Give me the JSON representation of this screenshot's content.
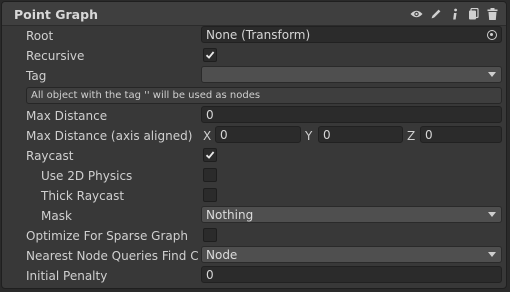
{
  "component": {
    "title": "Point Graph",
    "header_icons": [
      "eye-icon",
      "pencil-icon",
      "info-icon",
      "copy-icon",
      "trash-icon"
    ]
  },
  "fields": {
    "root": {
      "label": "Root",
      "value": "None (Transform)"
    },
    "recursive": {
      "label": "Recursive",
      "checked": true
    },
    "tag": {
      "label": "Tag",
      "value": ""
    },
    "tag_help": "All object with the tag '' will be used as nodes",
    "max_distance": {
      "label": "Max Distance",
      "value": "0"
    },
    "max_distance_axis": {
      "label": "Max Distance (axis aligned)",
      "x_label": "X",
      "x_value": "0",
      "y_label": "Y",
      "y_value": "0",
      "z_label": "Z",
      "z_value": "0"
    },
    "raycast": {
      "label": "Raycast",
      "checked": true
    },
    "use_2d_physics": {
      "label": "Use 2D Physics",
      "checked": false
    },
    "thick_raycast": {
      "label": "Thick Raycast",
      "checked": false
    },
    "mask": {
      "label": "Mask",
      "value": "Nothing"
    },
    "optimize_sparse": {
      "label": "Optimize For Sparse Graph",
      "checked": false
    },
    "nearest_node_queries": {
      "label": "Nearest Node Queries Find Clc",
      "value": "Node"
    },
    "initial_penalty": {
      "label": "Initial Penalty",
      "value": "0"
    }
  }
}
